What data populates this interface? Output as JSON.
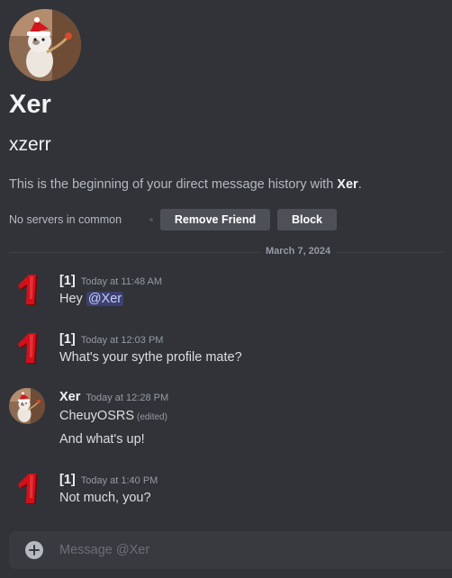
{
  "profile": {
    "display_name": "Xer",
    "username": "xzerr",
    "intro_prefix": "This is the beginning of your direct message history with ",
    "intro_name": "Xer",
    "intro_suffix": ".",
    "no_servers": "No servers in common",
    "remove_friend_label": "Remove Friend",
    "block_label": "Block",
    "avatar_icon": "cat-with-santa-hat-avatar"
  },
  "date_divider": "March 7, 2024",
  "messages": [
    {
      "author": "[1]",
      "time": "Today at 11:48 AM",
      "avatar_icon": "red-number-one-avatar",
      "text": "Hey ",
      "mention": "@Xer"
    },
    {
      "author": "[1]",
      "time": "Today at 12:03 PM",
      "avatar_icon": "red-number-one-avatar",
      "text": "What's your sythe profile mate?"
    },
    {
      "author": "Xer",
      "time": "Today at 12:28 PM",
      "avatar_icon": "cat-with-santa-hat-avatar",
      "text": "CheuyOSRS",
      "edited": "(edited)",
      "text2": "And what's up!"
    },
    {
      "author": "[1]",
      "time": "Today at 1:40 PM",
      "avatar_icon": "red-number-one-avatar",
      "text": "Not much, you?"
    }
  ],
  "composer": {
    "placeholder": "Message @Xer",
    "value": "",
    "add_icon": "plus-circle-icon"
  },
  "colors": {
    "background": "#313338",
    "button": "#4e5058",
    "mention_bg": "#3c4270",
    "avatar_red": "#d3101a"
  }
}
